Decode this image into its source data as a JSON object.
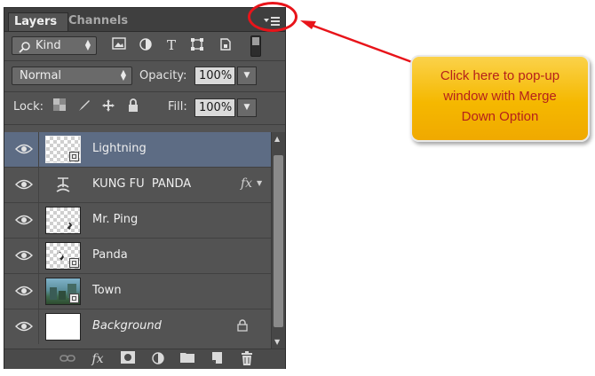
{
  "panel": {
    "tabs": [
      {
        "label": "Layers",
        "active": true
      },
      {
        "label": "Channels",
        "active": false
      }
    ],
    "filter": {
      "kind_label": "Kind"
    },
    "blend": {
      "mode": "Normal",
      "opacity_label": "Opacity:",
      "opacity_value": "100%"
    },
    "lock": {
      "label": "Lock:",
      "fill_label": "Fill:",
      "fill_value": "100%"
    },
    "layers": [
      {
        "name": "Lightning",
        "selected": true,
        "thumb": "checker-smart"
      },
      {
        "name": "KUNG FU  PANDA",
        "selected": false,
        "thumb": "warp-text",
        "fx": "fx"
      },
      {
        "name": "Mr. Ping",
        "selected": false,
        "thumb": "checker"
      },
      {
        "name": "Panda",
        "selected": false,
        "thumb": "checker-smart"
      },
      {
        "name": "Town",
        "selected": false,
        "thumb": "photo-smart"
      },
      {
        "name": "Background",
        "selected": false,
        "thumb": "white",
        "locked": true
      }
    ]
  },
  "callout": {
    "lines": [
      "Click here to pop-up",
      "window with Merge",
      "Down Option"
    ]
  },
  "colors": {
    "panel_bg": "#535353",
    "selected_row": "#5d6c84",
    "callout_fill": "#f5b800",
    "callout_text": "#b5211b",
    "annotation_red": "#e8141a"
  }
}
